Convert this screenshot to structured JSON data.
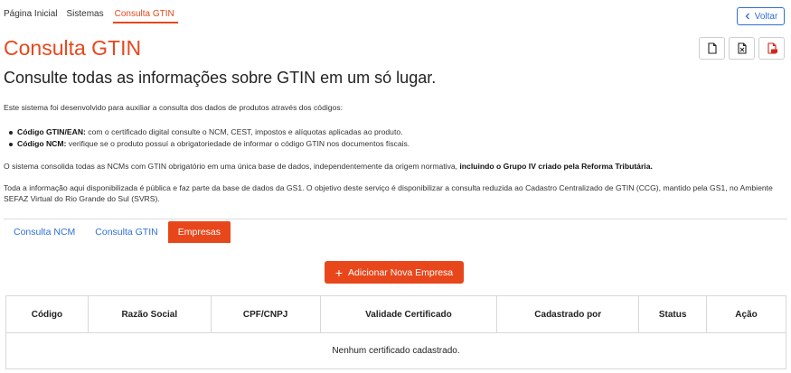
{
  "breadcrumb": {
    "items": [
      "Página Inicial",
      "Sistemas",
      "Consulta GTIN"
    ]
  },
  "header": {
    "back_label": "Voltar",
    "title": "Consulta GTIN",
    "subtitle": "Consulte todas as informações sobre GTIN em um só lugar.",
    "export_icons": [
      "pdf-file-icon",
      "excel-file-icon",
      "pdf-export-icon"
    ]
  },
  "intro": {
    "paragraph1": "Este sistema foi desenvolvido para auxiliar a consulta dos dados de produtos através dos códigos:",
    "bullets": [
      {
        "bold": "Código GTIN/EAN:",
        "text": " com o certificado digital consulte o NCM, CEST, impostos e alíquotas aplicadas ao produto."
      },
      {
        "bold": "Código NCM:",
        "text": " verifique se o produto possuí a obrigatoriedade de informar o código GTIN nos documentos fiscais."
      }
    ],
    "paragraph2_start": "O sistema consolida todas as NCMs com GTIN obrigatório em uma única base de dados, independentemente da origem normativa, ",
    "paragraph2_bold": "incluindo o Grupo IV criado pela Reforma Tributária.",
    "paragraph3": "Toda a informação aqui disponibilizada é pública e faz parte da base de dados da GS1. O objetivo deste serviço é disponibilizar a consulta reduzida ao Cadastro Centralizado de GTIN (CCG), mantido pela GS1, no Ambiente SEFAZ Virtual do Rio Grande do Sul (SVRS)."
  },
  "tabs": [
    {
      "label": "Consulta NCM",
      "active": false
    },
    {
      "label": "Consulta GTIN",
      "active": false
    },
    {
      "label": "Empresas",
      "active": true
    }
  ],
  "actions": {
    "add_company_label": "Adicionar Nova Empresa"
  },
  "table": {
    "columns": [
      "Código",
      "Razão Social",
      "CPF/CNPJ",
      "Validade Certificado",
      "Cadastrado por",
      "Status",
      "Ação"
    ],
    "empty_message": "Nenhum certificado cadastrado."
  },
  "colors": {
    "accent": "#e8471c",
    "link": "#2f6fd6"
  }
}
